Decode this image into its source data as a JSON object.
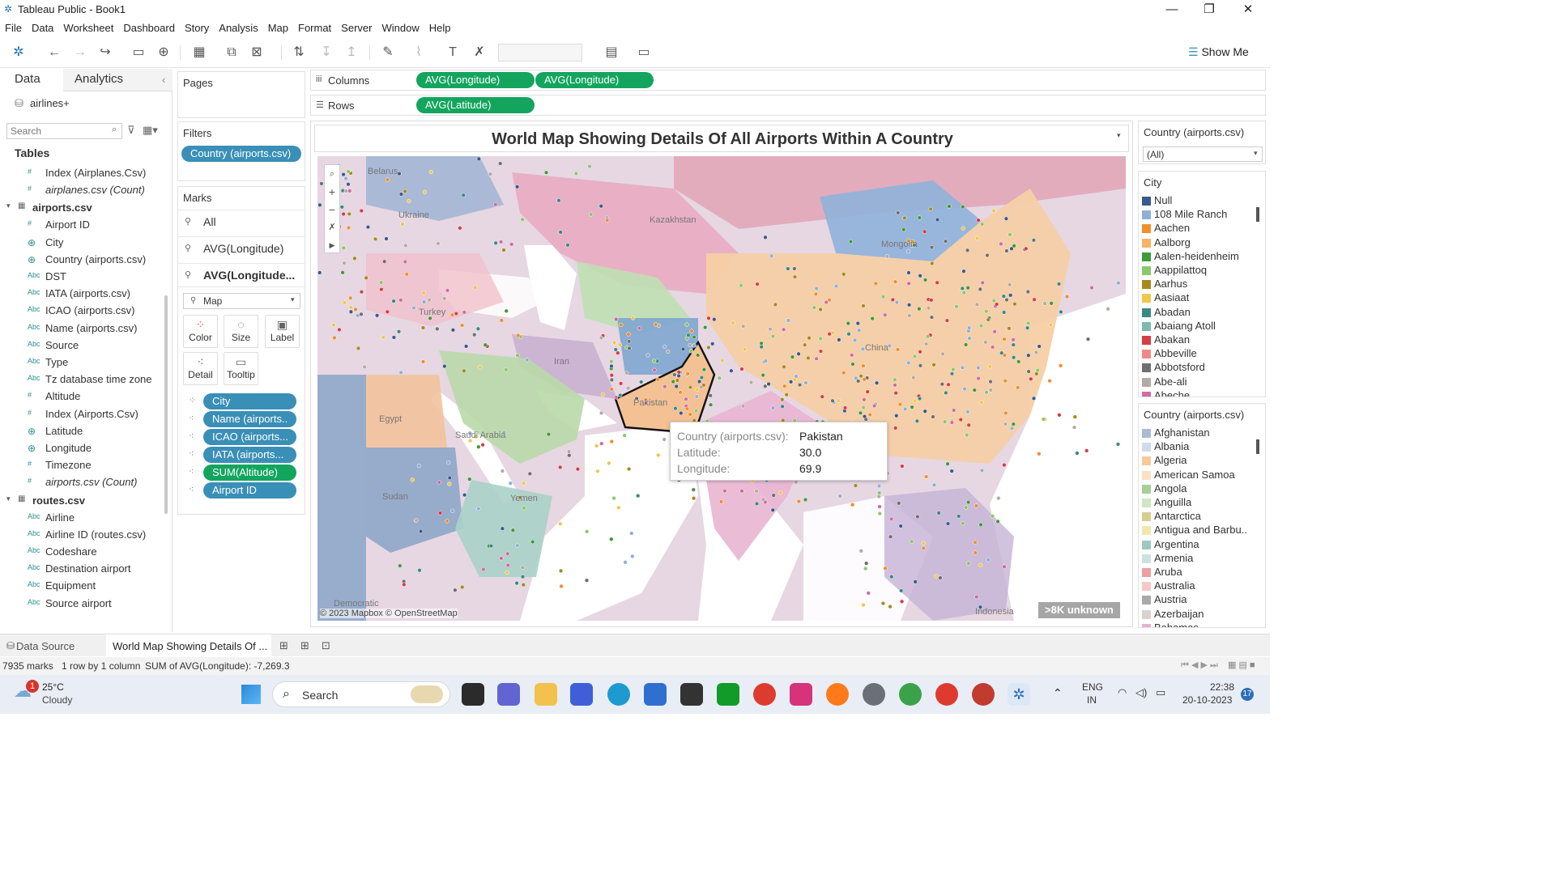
{
  "window": {
    "title": "Tableau Public - Book1",
    "minimize": "—",
    "maximize": "❐",
    "close": "✕"
  },
  "menu": [
    "File",
    "Data",
    "Worksheet",
    "Dashboard",
    "Story",
    "Analysis",
    "Map",
    "Format",
    "Server",
    "Window",
    "Help"
  ],
  "toolbar": {
    "show_me": "Show Me"
  },
  "data_pane": {
    "tab_data": "Data",
    "tab_analytics": "Analytics",
    "datasource": "airlines+",
    "search_placeholder": "Search",
    "tables_label": "Tables",
    "items": [
      {
        "kind": "field",
        "type": "#",
        "label": "Index (Airplanes.Csv)"
      },
      {
        "kind": "field",
        "type": "#",
        "label": "airplanes.csv (Count)",
        "italic": true
      },
      {
        "kind": "group",
        "label": "airports.csv"
      },
      {
        "kind": "field",
        "type": "#",
        "label": "Airport ID"
      },
      {
        "kind": "field",
        "type": "⊕",
        "label": "City"
      },
      {
        "kind": "field",
        "type": "⊕",
        "label": "Country (airports.csv)"
      },
      {
        "kind": "field",
        "type": "Abc",
        "label": "DST"
      },
      {
        "kind": "field",
        "type": "Abc",
        "label": "IATA (airports.csv)"
      },
      {
        "kind": "field",
        "type": "Abc",
        "label": "ICAO (airports.csv)"
      },
      {
        "kind": "field",
        "type": "Abc",
        "label": "Name (airports.csv)"
      },
      {
        "kind": "field",
        "type": "Abc",
        "label": "Source"
      },
      {
        "kind": "field",
        "type": "Abc",
        "label": "Type"
      },
      {
        "kind": "field",
        "type": "Abc",
        "label": "Tz database time zone"
      },
      {
        "kind": "field",
        "type": "#",
        "label": "Altitude"
      },
      {
        "kind": "field",
        "type": "#",
        "label": "Index (Airports.Csv)"
      },
      {
        "kind": "field",
        "type": "⊕",
        "label": "Latitude"
      },
      {
        "kind": "field",
        "type": "⊕",
        "label": "Longitude"
      },
      {
        "kind": "field",
        "type": "#",
        "label": "Timezone"
      },
      {
        "kind": "field",
        "type": "#",
        "label": "airports.csv (Count)",
        "italic": true
      },
      {
        "kind": "group",
        "label": "routes.csv"
      },
      {
        "kind": "field",
        "type": "Abc",
        "label": "Airline"
      },
      {
        "kind": "field",
        "type": "Abc",
        "label": "Airline ID (routes.csv)"
      },
      {
        "kind": "field",
        "type": "Abc",
        "label": "Codeshare"
      },
      {
        "kind": "field",
        "type": "Abc",
        "label": "Destination airport"
      },
      {
        "kind": "field",
        "type": "Abc",
        "label": "Equipment"
      },
      {
        "kind": "field",
        "type": "Abc",
        "label": "Source airport"
      }
    ]
  },
  "pages_label": "Pages",
  "filters": {
    "label": "Filters",
    "pill": "Country (airports.csv)"
  },
  "marks": {
    "label": "Marks",
    "layers": [
      "All",
      "AVG(Longitude)",
      "AVG(Longitude..."
    ],
    "mark_type": "Map",
    "buttons": [
      "Color",
      "Size",
      "Label",
      "Detail",
      "Tooltip"
    ],
    "pills": [
      {
        "icon": "⁘",
        "label": "City",
        "color": "blue"
      },
      {
        "icon": "⁖",
        "label": "Name (airports..",
        "color": "blue"
      },
      {
        "icon": "⁖",
        "label": "ICAO (airports...",
        "color": "blue"
      },
      {
        "icon": "⁖",
        "label": "IATA (airports...",
        "color": "blue"
      },
      {
        "icon": "⁖",
        "label": "SUM(Altitude)",
        "color": "green"
      },
      {
        "icon": "⁖",
        "label": "Airport ID",
        "color": "blue"
      }
    ]
  },
  "shelves": {
    "columns_label": "Columns",
    "columns": [
      "AVG(Longitude)",
      "AVG(Longitude)"
    ],
    "rows_label": "Rows",
    "rows": [
      "AVG(Latitude)"
    ]
  },
  "view": {
    "title": "World Map Showing Details Of All Airports Within A Country",
    "attribution": "© 2023 Mapbox © OpenStreetMap",
    "unknown_badge": ">8K unknown",
    "map_labels": [
      "Belarus",
      "Kazakhstan",
      "Mongolia",
      "Ukraine",
      "Turkey",
      "Iran",
      "China",
      "Pakistan",
      "Egypt",
      "Saudi Arabia",
      "Sudan",
      "Yemen",
      "Indonesia",
      "Democratic"
    ],
    "tooltip": {
      "rows": [
        {
          "k": "Country (airports.csv):",
          "v": "Pakistan"
        },
        {
          "k": "Latitude:",
          "v": "30.0"
        },
        {
          "k": "Longitude:",
          "v": "69.9"
        }
      ]
    }
  },
  "right_panel": {
    "country_filter_title": "Country (airports.csv)",
    "country_filter_value": "(All)",
    "city_legend_title": "City",
    "city_legend": [
      {
        "name": "Null",
        "color": "#3b5a8c"
      },
      {
        "name": "108 Mile Ranch",
        "color": "#8fb0d6"
      },
      {
        "name": "Aachen",
        "color": "#f28e2b"
      },
      {
        "name": "Aalborg",
        "color": "#f8b366"
      },
      {
        "name": "Aalen-heidenheim",
        "color": "#3f9a3a"
      },
      {
        "name": "Aappilattoq",
        "color": "#8cc96a"
      },
      {
        "name": "Aarhus",
        "color": "#a8891e"
      },
      {
        "name": "Aasiaat",
        "color": "#f1c84b"
      },
      {
        "name": "Abadan",
        "color": "#3a8a84"
      },
      {
        "name": "Abaiang Atoll",
        "color": "#7fb9b0"
      },
      {
        "name": "Abakan",
        "color": "#d63e45"
      },
      {
        "name": "Abbeville",
        "color": "#f08a8a"
      },
      {
        "name": "Abbotsford",
        "color": "#6f6f6f"
      },
      {
        "name": "Abe-ali",
        "color": "#b5aaa5"
      },
      {
        "name": "Abeche",
        "color": "#d26aa3"
      }
    ],
    "country_legend_title": "Country (airports.csv)",
    "country_legend": [
      {
        "name": "Afghanistan",
        "color": "#a8bcd6"
      },
      {
        "name": "Albania",
        "color": "#cfdcec"
      },
      {
        "name": "Algeria",
        "color": "#f6c99a"
      },
      {
        "name": "American Samoa",
        "color": "#fbe0c3"
      },
      {
        "name": "Angola",
        "color": "#a6cf9a"
      },
      {
        "name": "Anguilla",
        "color": "#cfe7c3"
      },
      {
        "name": "Antarctica",
        "color": "#d8cc92"
      },
      {
        "name": "Antigua and Barbu..",
        "color": "#f5e6ad"
      },
      {
        "name": "Argentina",
        "color": "#9fc8c2"
      },
      {
        "name": "Armenia",
        "color": "#cbe3df"
      },
      {
        "name": "Aruba",
        "color": "#ee9ea1"
      },
      {
        "name": "Australia",
        "color": "#f6c9c8"
      },
      {
        "name": "Austria",
        "color": "#a9a9a9"
      },
      {
        "name": "Azerbaijan",
        "color": "#d9d2cf"
      },
      {
        "name": "Bahamas",
        "color": "#e4b2ce"
      }
    ]
  },
  "bottom_tabs": {
    "data_source": "Data Source",
    "sheet": "World Map Showing Details Of ..."
  },
  "statusbar": {
    "marks": "7935 marks",
    "rowcol": "1 row by 1 column",
    "sum": "SUM of AVG(Longitude): -7,269.3"
  },
  "taskbar": {
    "weather_temp": "25°C",
    "weather_desc": "Cloudy",
    "weather_badge": "1",
    "search": "Search",
    "lang1": "ENG",
    "lang2": "IN",
    "time": "22:38",
    "date": "20-10-2023",
    "notif": "17"
  }
}
